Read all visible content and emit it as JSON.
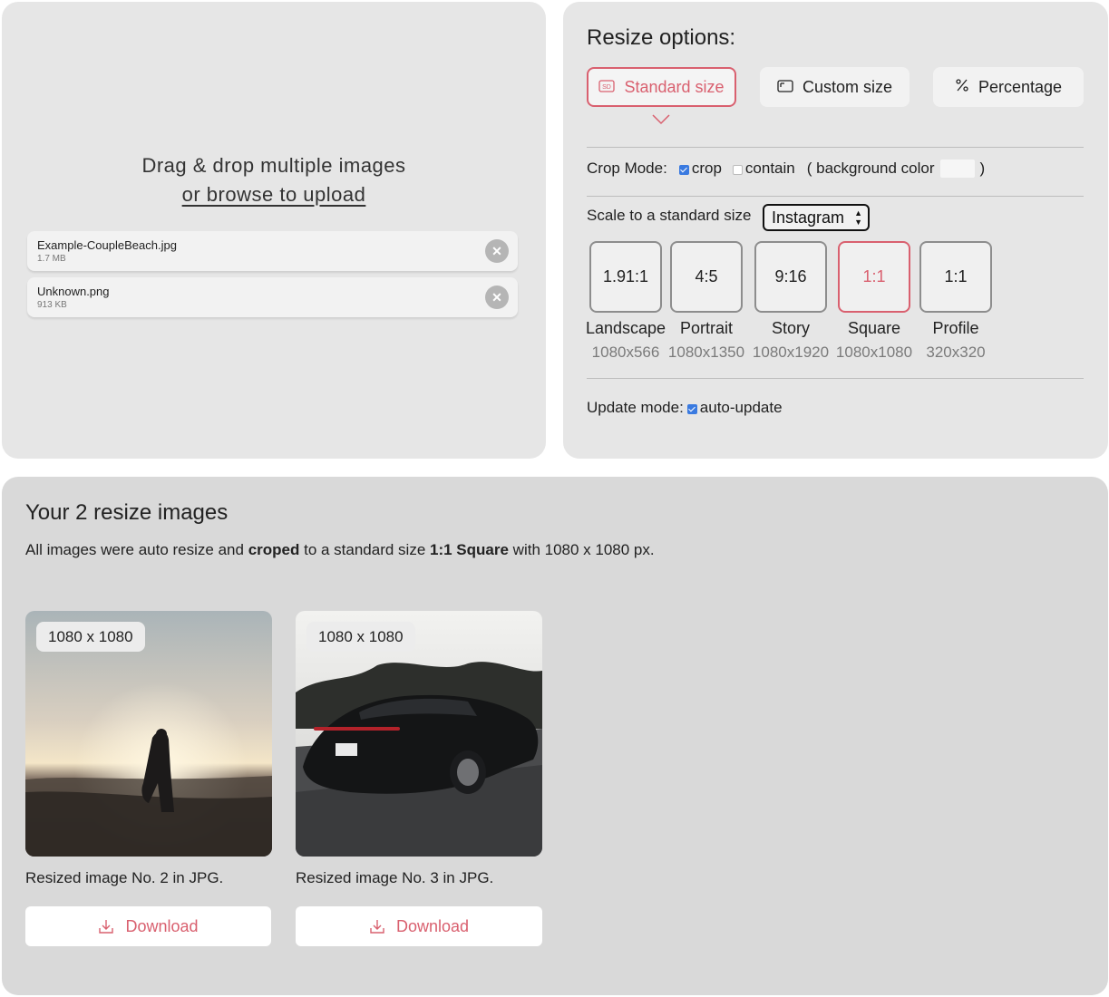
{
  "upload": {
    "drop_line1": "Drag & drop multiple images",
    "drop_line2": "or browse to upload",
    "files": [
      {
        "name": "Example-CoupleBeach.jpg",
        "size": "1.7 MB"
      },
      {
        "name": "Unknown.png",
        "size": "913 KB"
      }
    ],
    "remove_glyph": "✕"
  },
  "options": {
    "title": "Resize options:",
    "modes": [
      {
        "label": "Standard size",
        "icon": "sd-icon",
        "active": true
      },
      {
        "label": "Custom size",
        "icon": "frame-icon",
        "active": false
      },
      {
        "label": "Percentage",
        "icon": "percent-icon",
        "active": false
      }
    ],
    "crop_mode": {
      "label": "Crop Mode:",
      "crop": "crop",
      "contain": "contain",
      "bg_open": "( background color",
      "bg_close": ")",
      "crop_checked": true,
      "contain_checked": false
    },
    "scale": {
      "label": "Scale to a standard size",
      "selected": "Instagram"
    },
    "sizes": [
      {
        "ratio": "1.91:1",
        "name": "Landscape",
        "dims": "1080x566",
        "active": false
      },
      {
        "ratio": "4:5",
        "name": "Portrait",
        "dims": "1080x1350",
        "active": false
      },
      {
        "ratio": "9:16",
        "name": "Story",
        "dims": "1080x1920",
        "active": false
      },
      {
        "ratio": "1:1",
        "name": "Square",
        "dims": "1080x1080",
        "active": true
      },
      {
        "ratio": "1:1",
        "name": "Profile",
        "dims": "320x320",
        "active": false
      }
    ],
    "update_mode": {
      "label": "Update mode:",
      "option": "auto-update",
      "checked": true
    }
  },
  "results": {
    "title": "Your 2 resize images",
    "desc_part1": "All images were auto resize and ",
    "desc_bold1": "croped",
    "desc_part2": " to a standard size ",
    "desc_bold2": "1:1 Square",
    "desc_part3": " with 1080 x 1080 px.",
    "images": [
      {
        "badge": "1080 x 1080",
        "caption": "Resized image No. 2 in JPG.",
        "download": "Download"
      },
      {
        "badge": "1080 x 1080",
        "caption": "Resized image No. 3 in JPG.",
        "download": "Download"
      }
    ]
  },
  "colors": {
    "accent": "#d9606f",
    "panel": "#e6e6e6",
    "results_bg": "#d9d9d9",
    "checkbox": "#3a7ae0"
  }
}
